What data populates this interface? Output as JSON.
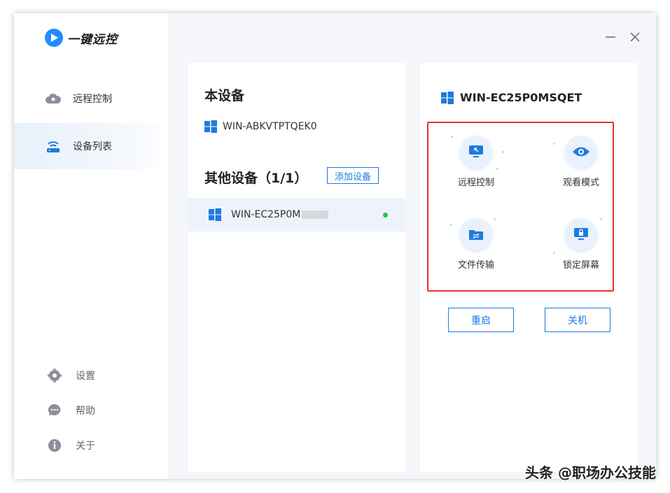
{
  "app": {
    "name": "一键远控"
  },
  "sidebar": {
    "items": [
      {
        "label": "远程控制",
        "icon": "cloud-remote-icon"
      },
      {
        "label": "设备列表",
        "icon": "router-icon"
      }
    ],
    "bottom": [
      {
        "label": "设置",
        "icon": "gear-icon"
      },
      {
        "label": "帮助",
        "icon": "chat-help-icon"
      },
      {
        "label": "关于",
        "icon": "info-icon"
      }
    ]
  },
  "this_device": {
    "title": "本设备",
    "name": "WIN-ABKVTPTQEK0"
  },
  "other_devices": {
    "title": "其他设备（1/1）",
    "add_label": "添加设备",
    "items": [
      {
        "name": "WIN-EC25P0M",
        "status": "online"
      }
    ]
  },
  "detail": {
    "device_name": "WIN-EC25P0MSQET",
    "actions": [
      {
        "label": "远程控制",
        "icon": "remote-desktop-icon"
      },
      {
        "label": "观看模式",
        "icon": "eye-icon"
      },
      {
        "label": "文件传输",
        "icon": "folder-transfer-icon"
      },
      {
        "label": "锁定屏幕",
        "icon": "lock-screen-icon"
      }
    ],
    "restart_label": "重启",
    "shutdown_label": "关机"
  },
  "watermark": "头条 @职场办公技能",
  "colors": {
    "accent": "#1f7ae0",
    "online": "#1ec25a",
    "highlight": "#e23232"
  }
}
